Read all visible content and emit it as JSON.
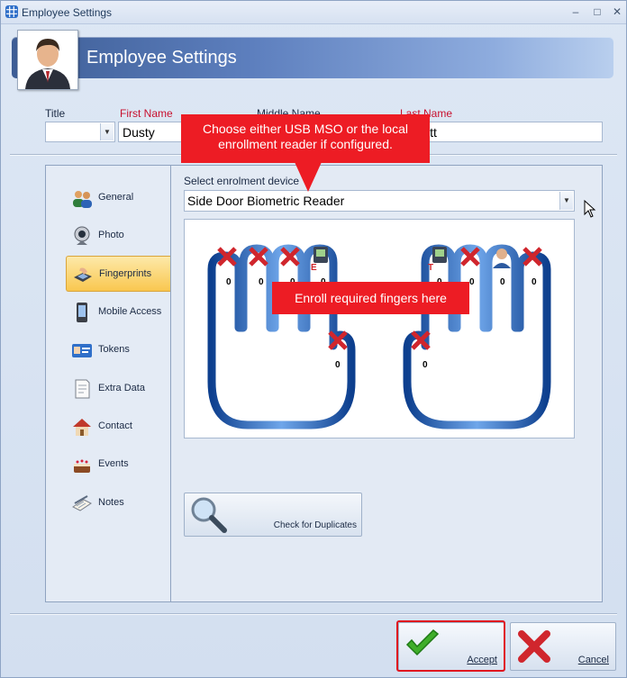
{
  "window": {
    "title": "Employee Settings"
  },
  "header": {
    "title": "Employee Settings"
  },
  "labels": {
    "title": "Title",
    "first_name": "First Name",
    "middle_name": "Middle Name",
    "last_name": "Last Name"
  },
  "fields": {
    "title_value": "",
    "first_name": "Dusty",
    "last_name_visible": "itt"
  },
  "nav": {
    "items": [
      {
        "label": "General",
        "icon": "people-icon"
      },
      {
        "label": "Photo",
        "icon": "webcam-icon"
      },
      {
        "label": "Fingerprints",
        "icon": "fingerprint-scanner-icon",
        "selected": true
      },
      {
        "label": "Mobile Access",
        "icon": "mobile-phone-icon"
      },
      {
        "label": "Tokens",
        "icon": "id-card-icon"
      },
      {
        "label": "Extra Data",
        "icon": "note-icon"
      },
      {
        "label": "Contact",
        "icon": "house-icon"
      },
      {
        "label": "Events",
        "icon": "cake-icon"
      },
      {
        "label": "Notes",
        "icon": "notes-icon"
      }
    ]
  },
  "enrolment": {
    "device_label": "Select enrolment device",
    "device_value": "Side Door Biometric Reader",
    "finger_counts": [
      "0",
      "0",
      "0",
      "0",
      "0",
      "0",
      "0",
      "0",
      "0",
      "0"
    ]
  },
  "buttons": {
    "check_duplicates": "Check for Duplicates",
    "accept": "Accept",
    "cancel": "Cancel"
  },
  "callouts": {
    "device": "Choose either USB MSO or the local enrollment reader if configured.",
    "fingers": "Enroll required fingers here"
  },
  "colors": {
    "callout": "#ed1c24",
    "nav_selected": "#f9c74f",
    "header": "#5d7fbe"
  }
}
